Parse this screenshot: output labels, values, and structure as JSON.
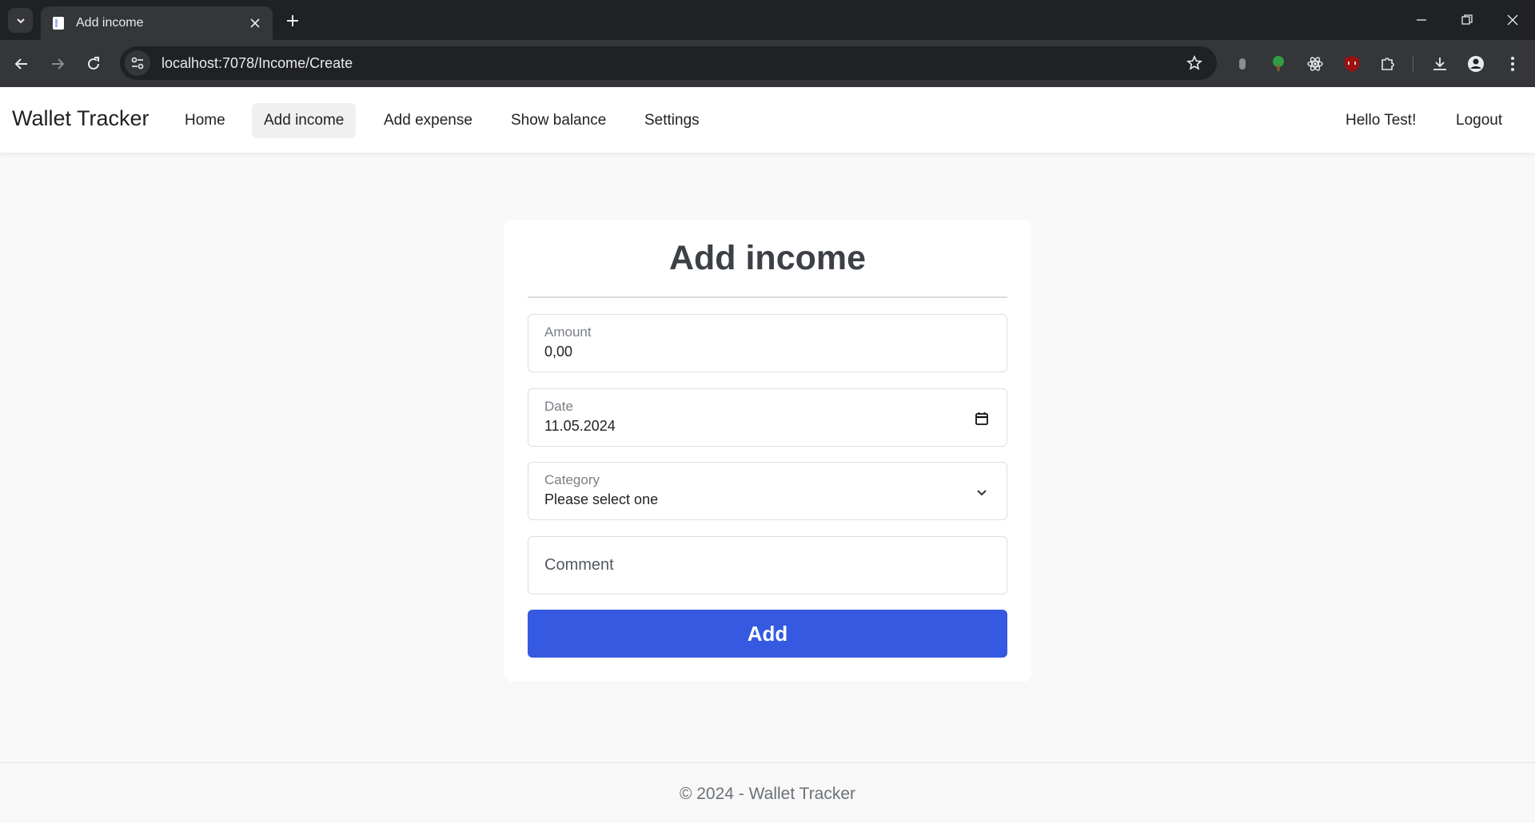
{
  "browser": {
    "tab_title": "Add income",
    "url": "localhost:7078/Income/Create"
  },
  "navbar": {
    "brand": "Wallet Tracker",
    "links": [
      {
        "label": "Home"
      },
      {
        "label": "Add income",
        "active": true
      },
      {
        "label": "Add expense"
      },
      {
        "label": "Show balance"
      },
      {
        "label": "Settings"
      }
    ],
    "greeting": "Hello Test!",
    "logout": "Logout"
  },
  "form": {
    "title": "Add income",
    "amount": {
      "label": "Amount",
      "value": "0,00"
    },
    "date": {
      "label": "Date",
      "value": "11.05.2024"
    },
    "category": {
      "label": "Category",
      "value": "Please select one"
    },
    "comment": {
      "placeholder": "Comment"
    },
    "submit_label": "Add"
  },
  "footer": {
    "text": "© 2024 - Wallet Tracker"
  },
  "colors": {
    "primary_button": "#3559e0",
    "chrome_dark": "#202124",
    "chrome_toolbar": "#35363a",
    "page_background": "#f8f8f8"
  },
  "icons": [
    "tab-search-chevron-icon",
    "page-favicon-icon",
    "close-icon",
    "plus-icon",
    "minimize-icon",
    "restore-icon",
    "window-close-icon",
    "back-arrow-icon",
    "forward-arrow-icon",
    "reload-icon",
    "site-settings-icon",
    "bookmark-star-icon",
    "extension-icon",
    "tree-extension-icon",
    "react-devtools-icon",
    "ublock-origin-icon",
    "puzzle-extensions-icon",
    "download-icon",
    "profile-icon",
    "kebab-menu-icon",
    "calendar-icon",
    "chevron-down-icon"
  ]
}
